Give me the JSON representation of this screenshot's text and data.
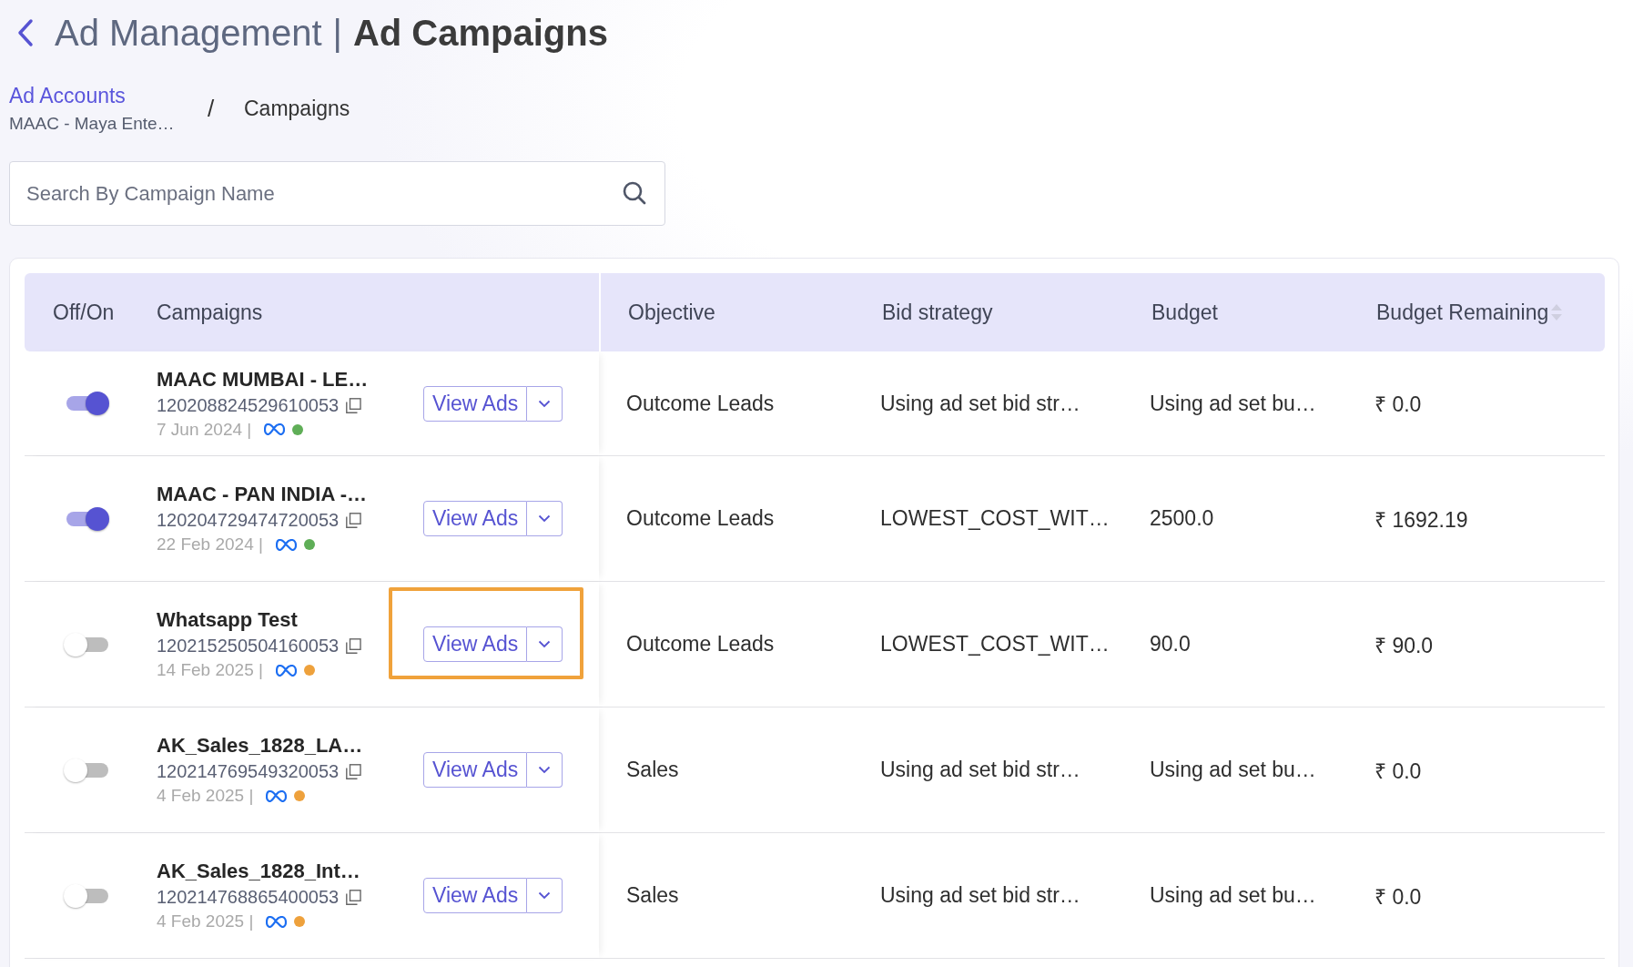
{
  "header": {
    "title_light": "Ad Management",
    "separator": "|",
    "title_bold": "Ad Campaigns"
  },
  "breadcrumb": {
    "link": "Ad Accounts",
    "account": "MAAC - Maya Ente…",
    "separator": "/",
    "current": "Campaigns"
  },
  "search": {
    "placeholder": "Search By Campaign Name"
  },
  "table": {
    "columns": [
      {
        "label": "Off/On",
        "sortable": false
      },
      {
        "label": "Campaigns",
        "sortable": false
      },
      {
        "label": "Objective",
        "sortable": false
      },
      {
        "label": "Bid strategy",
        "sortable": false
      },
      {
        "label": "Budget",
        "sortable": false
      },
      {
        "label": "Budget Remaining",
        "sortable": true
      }
    ],
    "rows": [
      {
        "on": true,
        "name": "MAAC MUMBAI - LE…",
        "id": "120208824529610053",
        "date": "7 Jun 2024 |",
        "color": "#5fae57",
        "button": "View Ads",
        "highlighted": false,
        "objective": "Outcome Leads",
        "bid_strategy": "Using ad set bid str…",
        "budget": "Using ad set bu…",
        "budget_remaining": "₹ 0.0"
      },
      {
        "on": true,
        "name": "MAAC - PAN INDIA -…",
        "id": "120204729474720053",
        "date": "22 Feb 2024 |",
        "color": "#5fae57",
        "button": "View Ads",
        "highlighted": false,
        "objective": "Outcome Leads",
        "bid_strategy": "LOWEST_COST_WIT…",
        "budget": "2500.0",
        "budget_remaining": "₹ 1692.19"
      },
      {
        "on": false,
        "name": "Whatsapp Test",
        "id": "120215250504160053",
        "date": "14 Feb 2025 |",
        "color": "#eea13c",
        "button": "View Ads",
        "highlighted": true,
        "objective": "Outcome Leads",
        "bid_strategy": "LOWEST_COST_WIT…",
        "budget": "90.0",
        "budget_remaining": "₹ 90.0"
      },
      {
        "on": false,
        "name": "AK_Sales_1828_LA…",
        "id": "120214769549320053",
        "date": "4 Feb 2025 |",
        "color": "#eea13c",
        "button": "View Ads",
        "highlighted": false,
        "objective": "Sales",
        "bid_strategy": "Using ad set bid str…",
        "budget": "Using ad set bu…",
        "budget_remaining": "₹ 0.0"
      },
      {
        "on": false,
        "name": "AK_Sales_1828_Int…",
        "id": "120214768865400053",
        "date": "4 Feb 2025 |",
        "color": "#eea13c",
        "button": "View Ads",
        "highlighted": false,
        "objective": "Sales",
        "bid_strategy": "Using ad set bid str…",
        "budget": "Using ad set bu…",
        "budget_remaining": "₹ 0.0"
      }
    ]
  }
}
